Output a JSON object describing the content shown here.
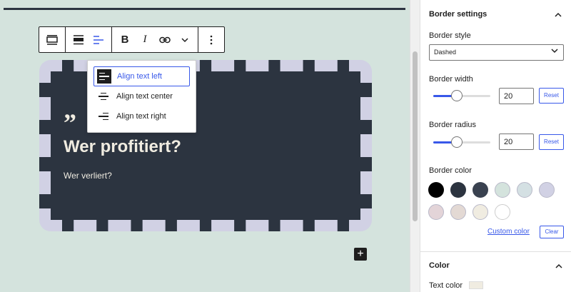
{
  "toolbar": {
    "tools": [
      {
        "name": "block-type",
        "icon": "quote-block-icon"
      },
      {
        "name": "block-align",
        "icon": "align-wide-icon"
      },
      {
        "name": "text-align",
        "icon": "align-left-icon"
      },
      {
        "name": "bold",
        "label": "B"
      },
      {
        "name": "italic",
        "label": "I"
      },
      {
        "name": "link",
        "icon": "link-icon"
      },
      {
        "name": "more-rich-text",
        "icon": "chevron-down-icon"
      },
      {
        "name": "options",
        "icon": "more-vertical-icon"
      }
    ]
  },
  "align_menu": {
    "items": [
      {
        "label": "Align text left",
        "selected": true
      },
      {
        "label": "Align text center",
        "selected": false
      },
      {
        "label": "Align text right",
        "selected": false
      }
    ]
  },
  "quote": {
    "mark": "”",
    "heading": "Wer profitiert?",
    "citation": "Wer verliert?",
    "background_color": "#2c3440",
    "border_color": "#d1d1e4",
    "text_color": "#f0ece1"
  },
  "sidebar": {
    "border_settings": {
      "title": "Border settings",
      "style_label": "Border style",
      "style_value": "Dashed",
      "width_label": "Border width",
      "width_value": "20",
      "radius_label": "Border radius",
      "radius_value": "20",
      "reset_label": "Reset",
      "color_label": "Border color",
      "custom_color_label": "Custom color",
      "clear_label": "Clear",
      "swatches": [
        "#000000",
        "#2c3440",
        "#3a4250",
        "#d4e3dd",
        "#d4e0e3",
        "#d1d1e4",
        "#e3d4d8",
        "#e3d9d4",
        "#f0ece1",
        "#ffffff"
      ]
    },
    "color": {
      "title": "Color",
      "text_color_label": "Text color",
      "text_color_value": "#f0ece1"
    }
  }
}
